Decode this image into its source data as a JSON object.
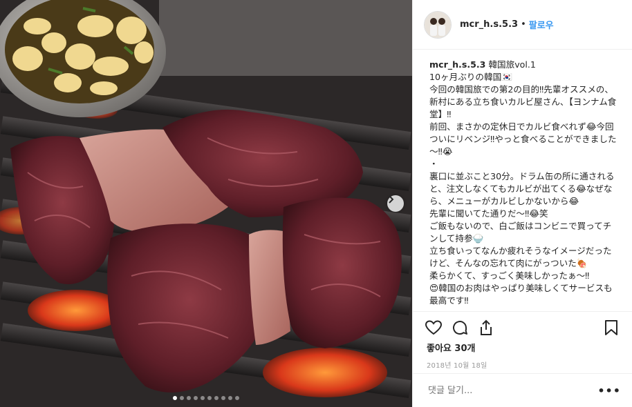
{
  "post": {
    "username": "mcr_h.s.5.3",
    "separator": "•",
    "follow_label": "팔로우",
    "caption_user": "mcr_h.s.5.3",
    "caption_text": " 韓国旅vol.1\n10ヶ月ぶりの韓国🇰🇷\n今回の韓国旅での第2の目的‼先輩オススメの、新村にある立ち食いカルビ屋さん、【ヨンナム食堂】‼\n前回、まさかの定休日でカルビ食べれず😂今回ついにリベンジ‼やっと食べることができました～‼😭\n・\n裏口に並ぶこと30分。ドラム缶の所に通されると、注文しなくてもカルビが出てくる😂なぜなら、メニューがカルビしかないから😂\n先輩に聞いてた通りだ～‼😂笑\nご飯もないので、白ご飯はコンビニで買ってチンして持参🍚\n立ち食いってなんか疲れそうなイメージだったけど、そんなの忘れて肉にがっついた🍖\n柔らかくて、すっごく美味しかったぁ～‼\n😍韓国のお肉はやっぱり美味しくてサービスも最高です‼",
    "likes_text": "좋아요 30개",
    "date_text": "2018년 10월 18일",
    "comment_placeholder": "댓글 달기...",
    "more_label": "•••"
  },
  "carousel": {
    "slide_count": 10,
    "active_index": 0
  },
  "icons": [
    "heart-icon",
    "comment-icon",
    "share-icon",
    "bookmark-icon",
    "chevron-right-icon"
  ],
  "colors": {
    "link_blue": "#3897f0",
    "text": "#262626",
    "muted": "#999999",
    "border": "#efefef"
  }
}
